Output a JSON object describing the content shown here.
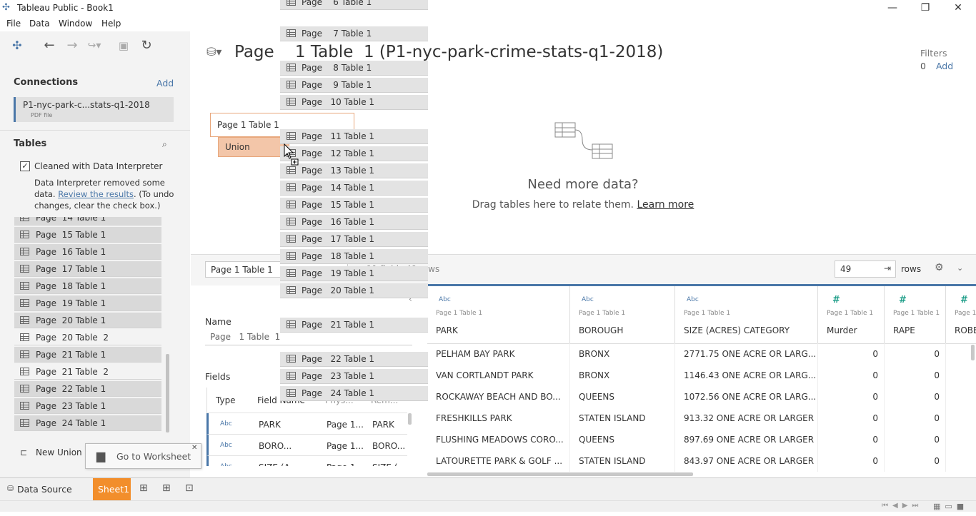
{
  "window": {
    "title": "Tableau Public - Book1",
    "minimize": "—",
    "maximize": "❐",
    "close": "✕"
  },
  "menu": [
    "File",
    "Data",
    "Window",
    "Help"
  ],
  "connections": {
    "title": "Connections",
    "add": "Add",
    "source_name": "P1-nyc-park-c...stats-q1-2018",
    "source_type": "PDF file"
  },
  "tables": {
    "title": "Tables",
    "interpreter_label": "Cleaned with Data Interpreter",
    "note_pre": "Data Interpreter removed some data. ",
    "note_link": "Review the results",
    "note_post": ". (To undo changes, clear the check box.)",
    "items": [
      {
        "label": "Page  14 Table 1",
        "sel": true
      },
      {
        "label": "Page  15 Table 1",
        "sel": true
      },
      {
        "label": "Page  16 Table 1",
        "sel": true
      },
      {
        "label": "Page  17 Table 1",
        "sel": true
      },
      {
        "label": "Page  18 Table 1",
        "sel": true
      },
      {
        "label": "Page  19 Table 1",
        "sel": true
      },
      {
        "label": "Page  20 Table 1",
        "sel": true
      },
      {
        "label": "Page  20 Table  2",
        "sel": false
      },
      {
        "label": "Page  21 Table 1",
        "sel": true
      },
      {
        "label": "Page  21 Table  2",
        "sel": false
      },
      {
        "label": "Page  22 Table 1",
        "sel": true
      },
      {
        "label": "Page  23 Table 1",
        "sel": true
      },
      {
        "label": "Page  24 Table 1",
        "sel": true
      }
    ],
    "new_union": "New Union"
  },
  "tooltip": {
    "label": "Go to Worksheet",
    "close": "✕"
  },
  "canvas": {
    "title": "Page    1 Table  1 (P1-nyc-park-crime-stats-q1-2018)",
    "filters_label": "Filters",
    "filters_count": "0",
    "filters_add": "Add",
    "table_pill": "Page 1 Table 1",
    "union_label": "Union",
    "need_more_title": "Need more data?",
    "need_more_text": "Drag tables here to relate them.",
    "learn_more": "Learn more"
  },
  "drag_list": [
    "Page    6 Table 1",
    "Page    7 Table 1",
    "Page    8 Table 1",
    "Page    9 Table 1",
    "Page   10 Table 1",
    "Page   11 Table 1",
    "Page   12 Table 1",
    "Page   13 Table 1",
    "Page   14 Table 1",
    "Page   15 Table 1",
    "Page   16 Table 1",
    "Page   17 Table 1",
    "Page   18 Table 1",
    "Page   19 Table 1",
    "Page   20 Table 1",
    "Page   21 Table 1",
    "Page   22 Table 1",
    "Page   23 Table 1",
    "Page   24 Table 1"
  ],
  "grid": {
    "table_select": "Page 1 Table 1",
    "summary": "11 fields 49 rows",
    "rows_value": "49",
    "rows_label": "rows",
    "columns": [
      {
        "type": "Abc",
        "source": "Page 1 Table 1",
        "name": "PARK"
      },
      {
        "type": "Abc",
        "source": "Page 1 Table 1",
        "name": "BOROUGH"
      },
      {
        "type": "Abc",
        "source": "Page 1 Table 1",
        "name": "SIZE (ACRES) CATEGORY"
      },
      {
        "type": "#",
        "source": "Page 1 Table 1",
        "name": "Murder"
      },
      {
        "type": "#",
        "source": "Page 1 Table 1",
        "name": "RAPE"
      },
      {
        "type": "#",
        "source": "Page 1",
        "name": "ROBB"
      }
    ],
    "rows": [
      [
        "PELHAM BAY PARK",
        "BRONX",
        "2771.75 ONE ACRE OR LARG...",
        "0",
        "0"
      ],
      [
        "VAN CORTLANDT PARK",
        "BRONX",
        "1146.43 ONE ACRE OR LARG...",
        "0",
        "0"
      ],
      [
        "ROCKAWAY BEACH AND BO...",
        "QUEENS",
        "1072.56 ONE ACRE OR LARG...",
        "0",
        "0"
      ],
      [
        "FRESHKILLS PARK",
        "STATEN ISLAND",
        "913.32 ONE ACRE OR LARGER",
        "0",
        "0"
      ],
      [
        "FLUSHING MEADOWS CORO...",
        "QUEENS",
        "897.69 ONE ACRE OR LARGER",
        "0",
        "0"
      ],
      [
        "LATOURETTE PARK & GOLF ...",
        "STATEN ISLAND",
        "843.97 ONE ACRE OR LARGER",
        "0",
        "0"
      ]
    ]
  },
  "meta": {
    "name_label": "Name",
    "name_value": "Page   1 Table  1",
    "fields_label": "Fields",
    "headers": [
      "Type",
      "Field Name",
      "Phys...",
      "Rem..."
    ],
    "rows": [
      [
        "Abc",
        "PARK",
        "Page 1...",
        "PARK"
      ],
      [
        "Abc",
        "BORO...",
        "Page 1...",
        "BORO..."
      ],
      [
        "Abc",
        "SIZE (A...",
        "Page 1...",
        "SIZE (..."
      ]
    ]
  },
  "tabs": {
    "data_source": "Data Source",
    "sheet": "Sheet1"
  },
  "colors": {
    "accent": "#4a77a8",
    "orange_tab": "#f28e2b",
    "union": "#f3c6a9",
    "teal": "#1f9e89"
  }
}
